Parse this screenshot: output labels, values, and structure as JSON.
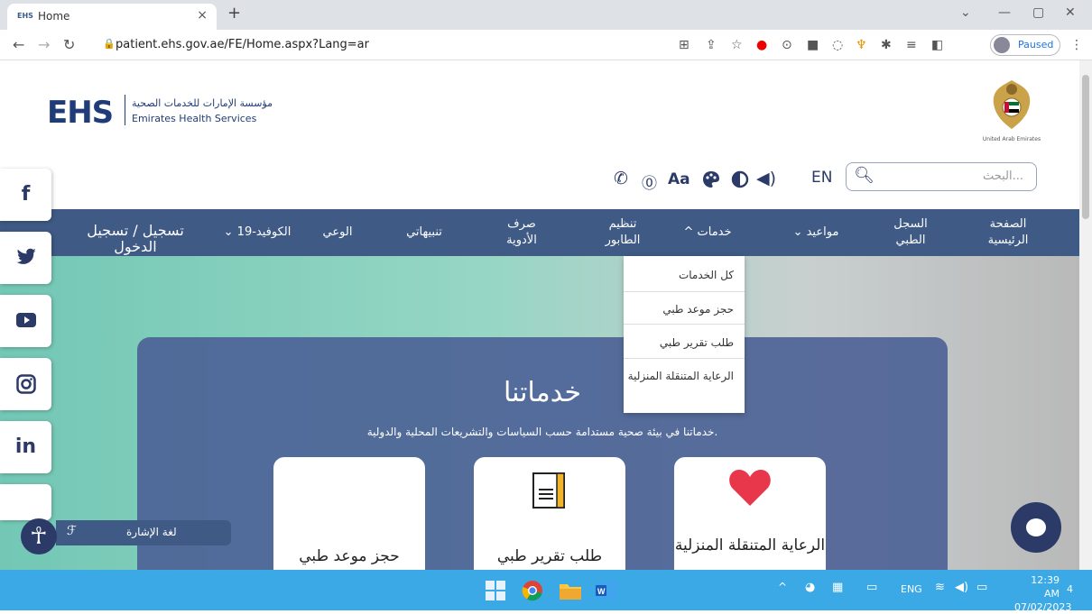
{
  "browser": {
    "tab_favicon": "EHS",
    "tab_title": "Home",
    "tab_close": "×",
    "new_tab": "+",
    "url": "patient.ehs.gov.ae/FE/Home.aspx?Lang=ar",
    "profile_status": "Paused"
  },
  "header": {
    "logo_text": "EHS",
    "logo_arabic": "مؤسسة الإمارات للخدمات الصحية",
    "logo_english": "Emirates Health Services",
    "emblem_caption": "United Arab Emirates",
    "lang_link": "EN",
    "search_placeholder": "البحث...",
    "tools": [
      "phone-icon",
      "help-icon",
      "font-size-icon",
      "palette-icon",
      "contrast-icon",
      "audio-icon"
    ],
    "font_size_label": "Aa"
  },
  "nav": {
    "home": "الصفحة الرئيسية",
    "medical_record": "السجل الطبي",
    "appointments": "مواعيد",
    "services": "خدمات",
    "queue": "تنظيم الطابور",
    "dispensing": "صرف الأدوية",
    "alerts": "تنبيهاتي",
    "awareness": "الوعي",
    "covid": "الكوفيد-19",
    "login": "تسجيل / تسجيل الدخول"
  },
  "services_menu": [
    "كل الخدمات",
    "حجز موعد طبي",
    "طلب تقرير طبي",
    "الرعاية المتنقلة المنزلية"
  ],
  "hero": {
    "title": "خدماتنا",
    "subtitle": "خدماتنا في بيئة صحية مستدامة حسب السياسات والتشريعات المحلية والدولية.",
    "cards": [
      "الرعاية المتنقلة المنزلية",
      "طلب تقرير طبي",
      "حجز موعد طبي"
    ]
  },
  "social": [
    "f",
    "twitter-icon",
    "youtube-icon",
    "instagram-icon",
    "in"
  ],
  "accessibility": {
    "sign_language": "لغة الإشارة"
  },
  "taskbar": {
    "lang": "ENG",
    "time": "12:39 AM",
    "date": "07/02/2023",
    "notifications": "4"
  },
  "colors": {
    "primary": "#3f5a85",
    "dark": "#2b3a67",
    "taskbar": "#3aa9e5"
  }
}
